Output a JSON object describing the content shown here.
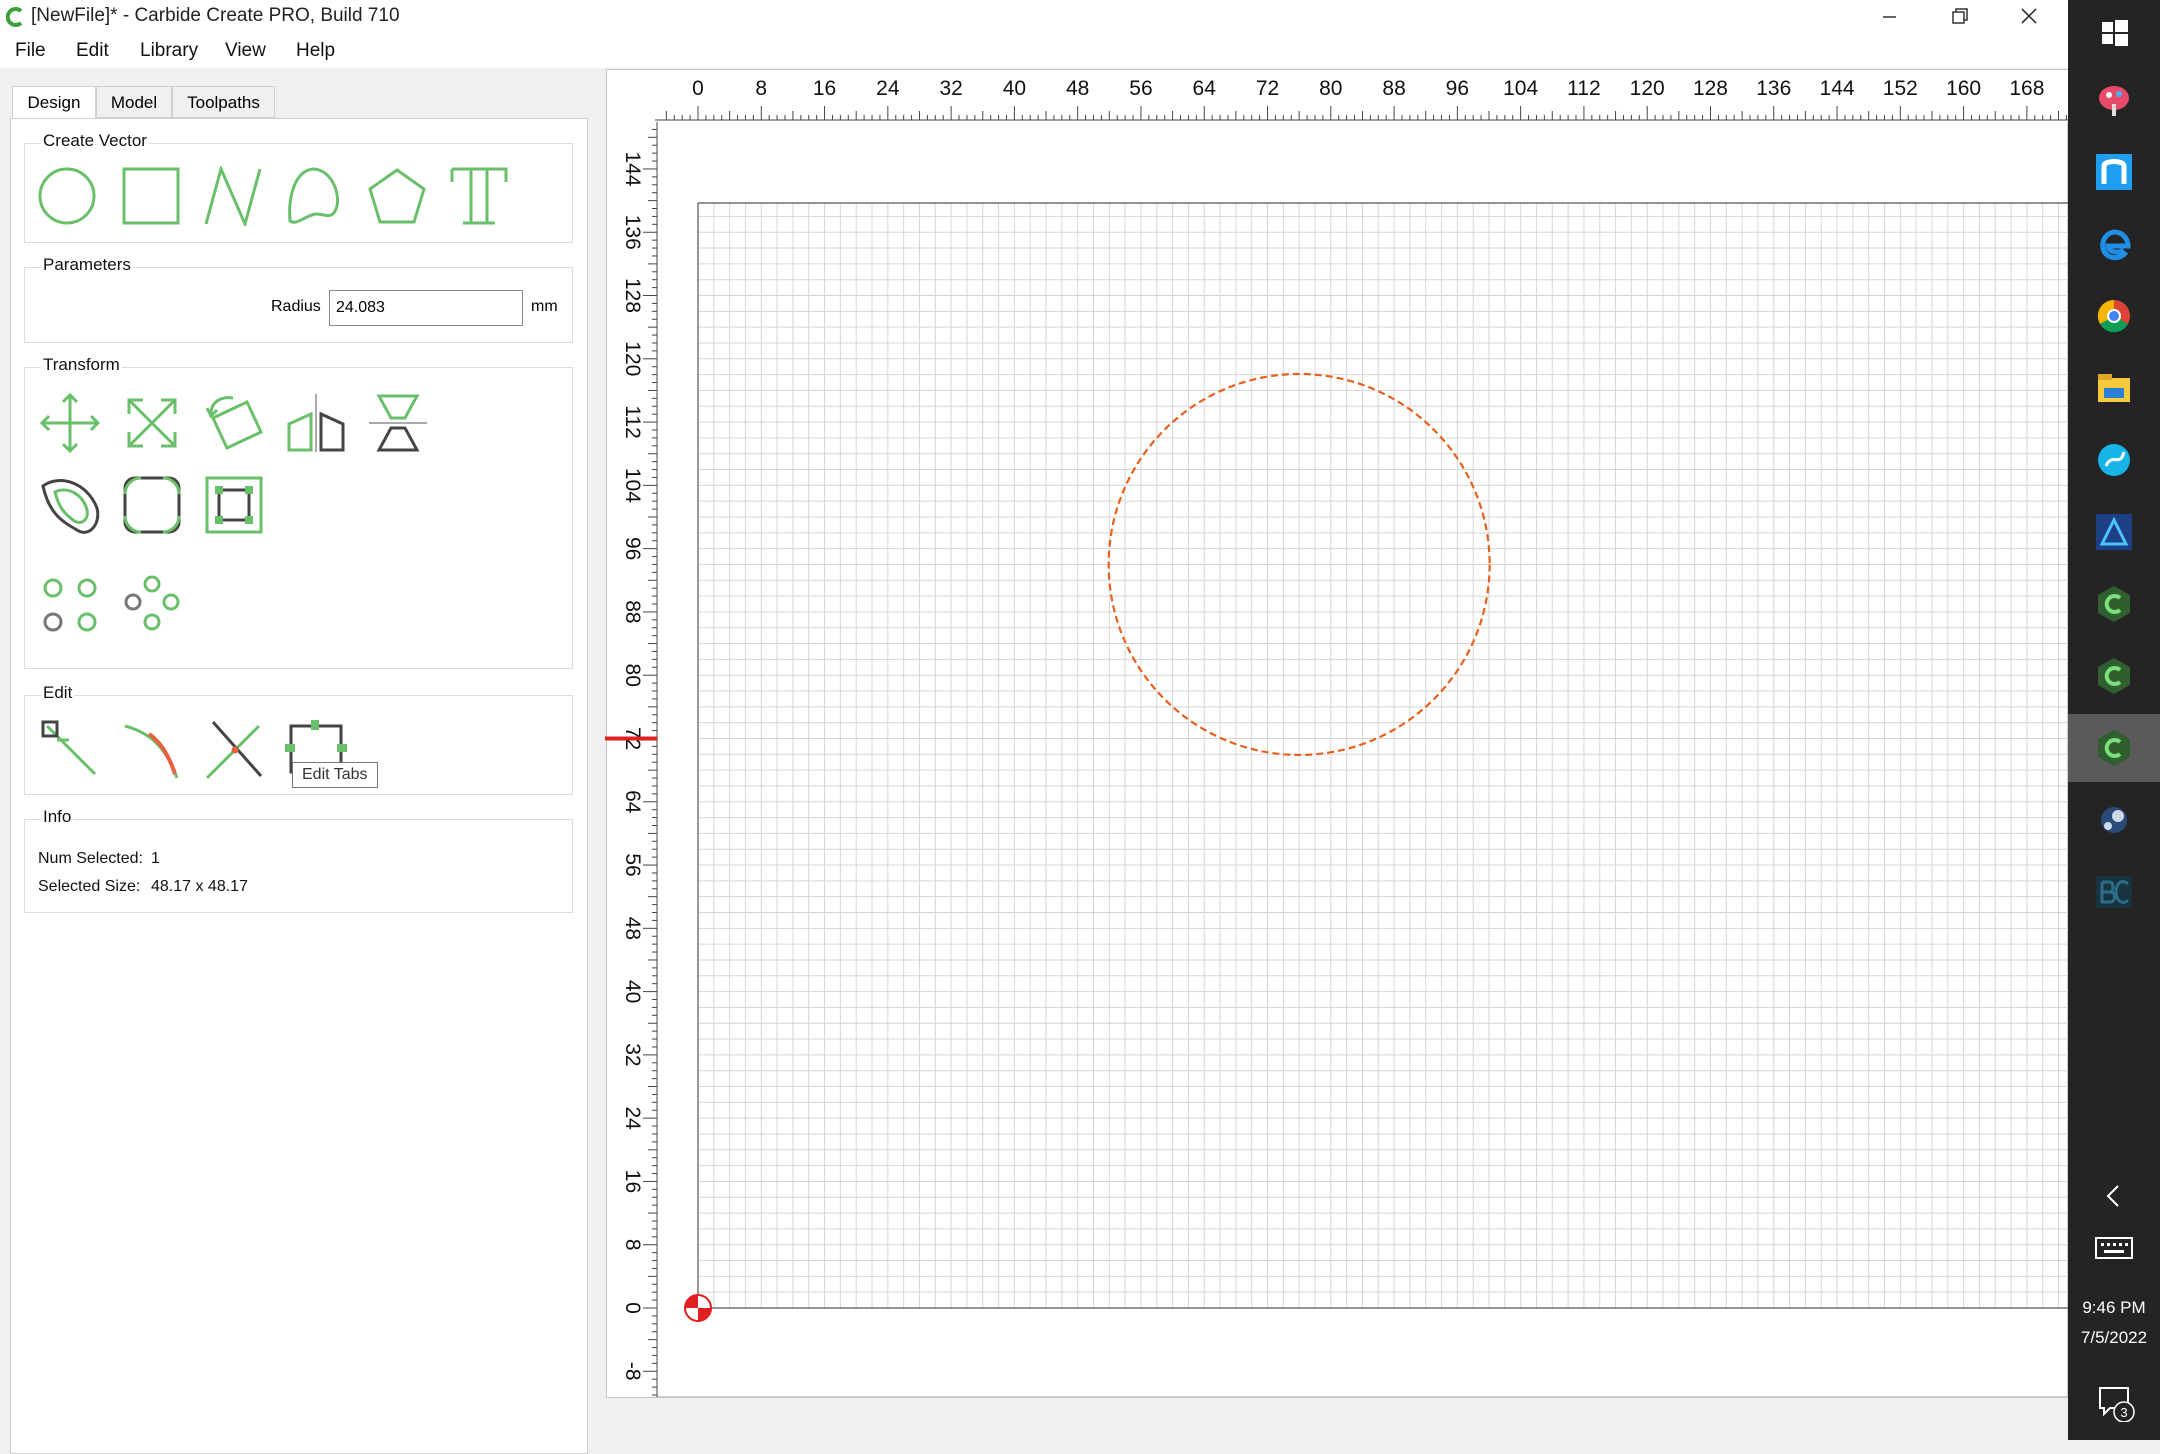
{
  "window": {
    "title": "[NewFile]* - Carbide Create PRO, Build 710"
  },
  "menu": [
    "File",
    "Edit",
    "Library",
    "View",
    "Help"
  ],
  "tabs": [
    "Design",
    "Model",
    "Toolpaths"
  ],
  "active_tab": "Design",
  "sections": {
    "create_vector": "Create Vector",
    "parameters": "Parameters",
    "transform": "Transform",
    "edit": "Edit",
    "info": "Info"
  },
  "parameters": {
    "radius_label": "Radius",
    "radius_value": "24.083",
    "unit": "mm"
  },
  "info": {
    "num_selected_label": "Num Selected:",
    "num_selected_value": "1",
    "selected_size_label": "Selected Size:",
    "selected_size_value": "48.17 x 48.17"
  },
  "tooltip": "Edit Tabs",
  "rulers": {
    "x_labels": [
      "0",
      "8",
      "16",
      "24",
      "32",
      "40",
      "48",
      "56",
      "64",
      "72",
      "80",
      "88",
      "96",
      "104",
      "112",
      "120",
      "128",
      "136",
      "144",
      "152",
      "160",
      "168"
    ],
    "y_labels": [
      "144",
      "136",
      "128",
      "120",
      "112",
      "104",
      "96",
      "88",
      "80",
      "72",
      "64",
      "56",
      "48",
      "40",
      "32",
      "24",
      "16",
      "8",
      "0",
      "-8"
    ]
  },
  "drawing": {
    "circle_center": [
      76.0,
      94.0
    ],
    "circle_radius": 24.083,
    "circle_color": "#e8601c",
    "grid_spacing": 2
  },
  "taskbar": {
    "time": "9:46 PM",
    "date": "7/5/2022",
    "notification_count": "3"
  },
  "colors": {
    "tool_green": "#6abf6a",
    "tool_dark": "#444444",
    "accent_red": "#e02020"
  }
}
